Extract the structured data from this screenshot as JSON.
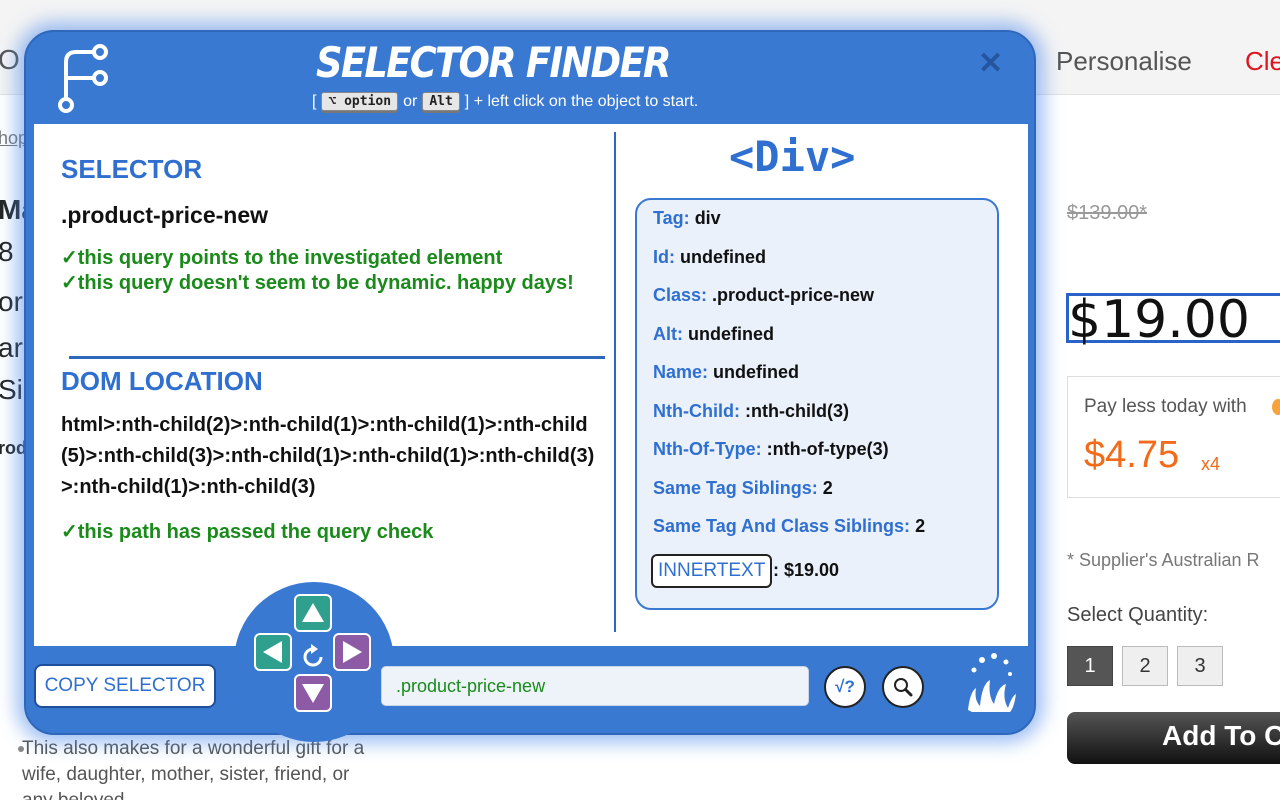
{
  "background": {
    "nav_partial_o": "O",
    "nav_personalise": "Personalise",
    "nav_clear_partial": "Cle",
    "crumb_partial": "hop",
    "left_partial": [
      "Ma",
      "8",
      "ori",
      "ar",
      "Sir"
    ],
    "left_small_partial": "rod",
    "old_price": "$139.00*",
    "price": "$19.00",
    "pay_text": "Pay less today with",
    "pay_amount": "$4.75",
    "pay_multiplier": "x4",
    "supplier_note": "* Supplier's Australian R",
    "qty_label": "Select Quantity:",
    "qty_options": [
      "1",
      "2",
      "3"
    ],
    "add_to_cart": "Add To C",
    "bullet_text": "This also makes for a wonderful gift for a wife, daughter, mother, sister, friend, or any beloved"
  },
  "panel": {
    "title": "SELECTOR FINDER",
    "hint_open": "[",
    "key_option": "⌥ option",
    "hint_or": "or",
    "key_alt": "Alt",
    "hint_rest": "] + left click on the object to start.",
    "close_symbol": "✕",
    "selector_heading": "SELECTOR",
    "selector_value": ".product-price-new",
    "selector_check_1": "✓this query points to the investigated element",
    "selector_check_2": "✓this query doesn't seem to be dynamic. happy days!",
    "dom_heading": "DOM LOCATION",
    "dom_path": "html>:nth-child(2)>:nth-child(1)>:nth-child(1)>:nth-child(5)>:nth-child(3)>:nth-child(1)>:nth-child(1)>:nth-child(3)>:nth-child(1)>:nth-child(3)",
    "dom_check": "✓this path has passed the query check",
    "tag_title": "<Div>",
    "info": [
      {
        "key": "Tag:",
        "value": "div"
      },
      {
        "key": "Id:",
        "value": "undefined"
      },
      {
        "key": "Class:",
        "value": ".product-price-new"
      },
      {
        "key": "Alt:",
        "value": "undefined"
      },
      {
        "key": "Name:",
        "value": "undefined"
      },
      {
        "key": "Nth-Child:",
        "value": ":nth-child(3)"
      },
      {
        "key": "Nth-Of-Type:",
        "value": ":nth-of-type(3)"
      },
      {
        "key": "Same Tag Siblings:",
        "value": "2"
      },
      {
        "key": "Same Tag And Class Siblings:",
        "value": "2"
      }
    ],
    "innertext_label": "INNERTEXT",
    "innertext_value": ": $19.00",
    "copy_button": "COPY SELECTOR",
    "selector_input_value": ".product-price-new",
    "check_button": "√?",
    "colors": {
      "panel_blue": "#3a79d2",
      "accent_green": "#1a8a1a",
      "heading_blue": "#2f6fcf",
      "up_left_arrow": "#30a08e",
      "right_down_arrow": "#8d5aa5"
    },
    "icons": [
      "selector-finder-logo-icon",
      "close-icon",
      "arrow-up-icon",
      "arrow-left-icon",
      "arrow-right-icon",
      "arrow-down-icon",
      "reset-icon",
      "magnifier-icon",
      "splash-icon"
    ]
  }
}
